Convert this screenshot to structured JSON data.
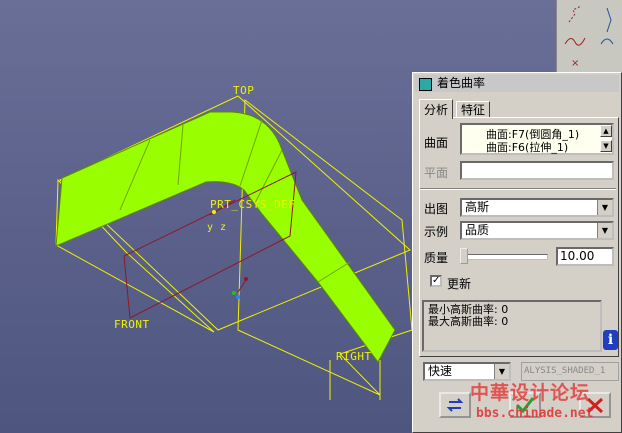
{
  "viewport": {
    "datum_labels": {
      "top": "TOP",
      "front": "FRONT",
      "right": "RIGHT",
      "csys": "PRT_CSYS_DEF",
      "axes": "y z"
    }
  },
  "toolbar": {
    "icons": [
      "sketch-curve-icon",
      "spline-icon",
      "point-icon",
      "feature-icon"
    ]
  },
  "dialog": {
    "title": "着色曲率",
    "tabs": [
      "分析",
      "特征"
    ],
    "active_tab": "分析",
    "curve_label": "曲面",
    "curve_items": [
      "曲面:F7(倒圆角_1)",
      "曲面:F6(拉伸_1)"
    ],
    "plane_label": "平面",
    "plane_value": "",
    "output_label": "出图",
    "output_value": "高斯",
    "example_label": "示例",
    "example_value": "品质",
    "quality_label": "质量",
    "quality_value": "10.00",
    "quality_level": 0.0,
    "update_label": "更新",
    "update_checked": true,
    "results": [
      "最小高斯曲率: 0",
      "最大高斯曲率: 0"
    ],
    "speed_value": "快速",
    "analysis_name": "ALYSIS_SHADED_1"
  },
  "watermark": {
    "big": "中華设计论坛",
    "small": "bbs.chinade.net"
  },
  "colors": {
    "surface": "#99ff00",
    "datum": "#f0f000",
    "csys_red": "#8b1a2a",
    "panel_bg": "#d4d0c8"
  }
}
